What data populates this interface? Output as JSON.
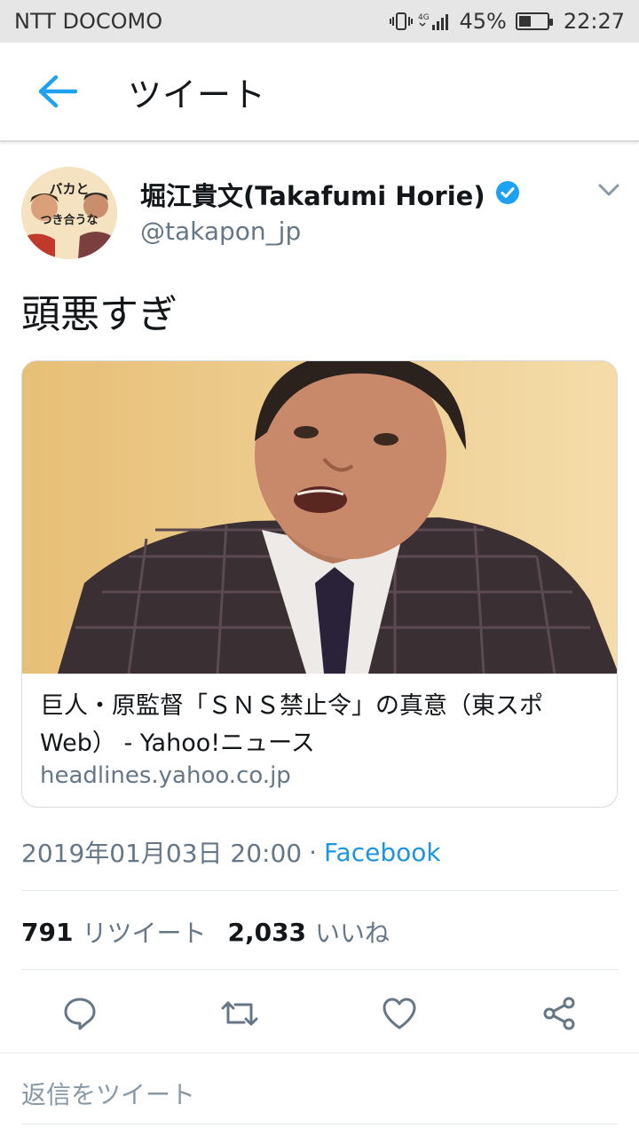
{
  "status_bar": {
    "carrier": "NTT DOCOMO",
    "network": "4G",
    "battery": "45%",
    "battery_level": 0.45,
    "time": "22:27"
  },
  "app_bar": {
    "title": "ツイート",
    "back_icon": "arrow-left-icon"
  },
  "tweet": {
    "author_name": "堀江貴文(Takafumi Horie)",
    "handle": "@takapon_jp",
    "verified": true,
    "avatar_text": [
      "バカと",
      "つき合うな"
    ],
    "text": "頭悪すぎ",
    "card": {
      "title": "巨人・原監督「ＳＮＳ禁止令」の真意（東スポWeb） - Yahoo!ニュース",
      "domain": "headlines.yahoo.co.jp"
    },
    "timestamp": "2019年01月03日 20:00",
    "separator": "·",
    "source": "Facebook",
    "retweet_count": "791",
    "retweet_label": "リツイート",
    "like_count": "2,033",
    "like_label": "いいね"
  },
  "reply": {
    "placeholder": "返信をツイート"
  },
  "colors": {
    "accent": "#1da1f2",
    "link": "#1b95e0",
    "secondary_text": "#657786",
    "icon": "#657786"
  }
}
